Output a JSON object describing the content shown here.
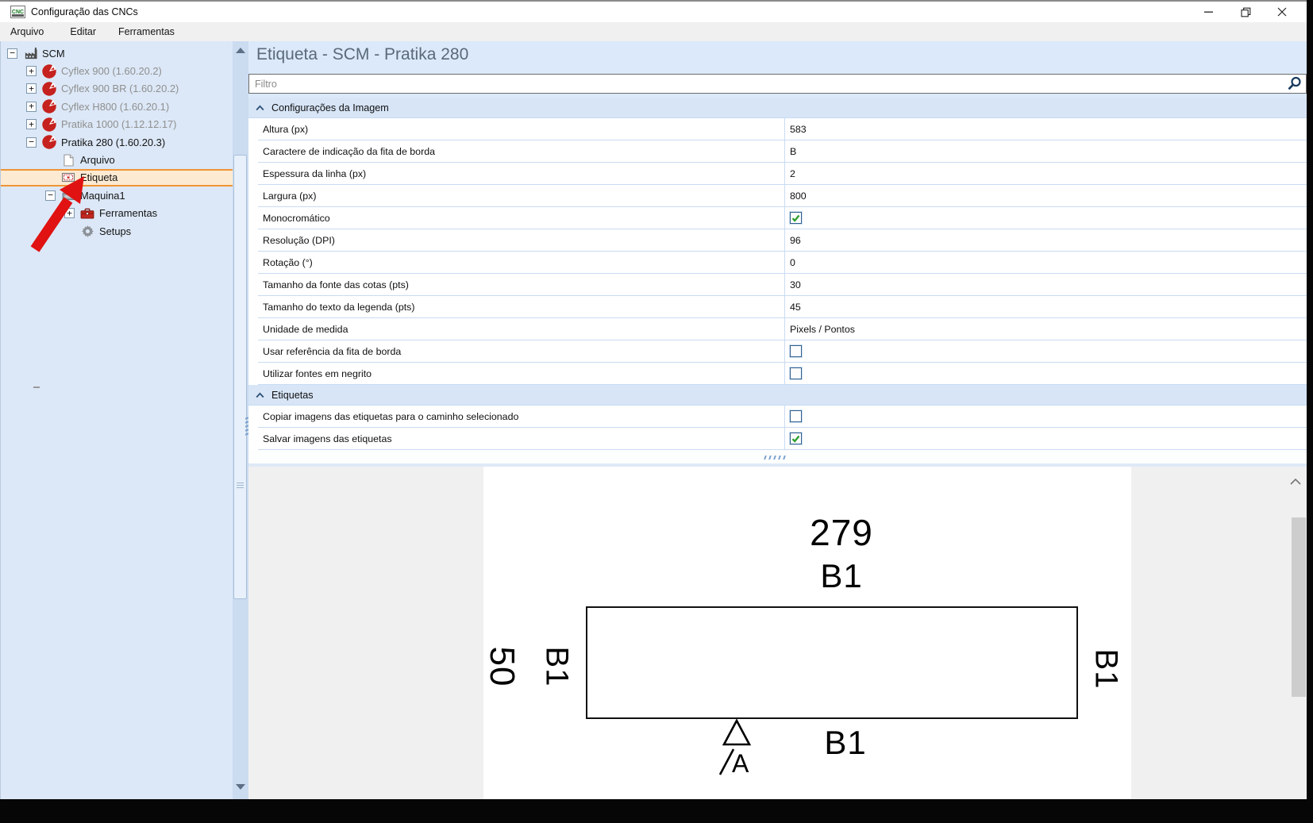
{
  "window": {
    "title": "Configuração das CNCs",
    "controls": [
      {
        "name": "minimize",
        "icon": "minimize-icon"
      },
      {
        "name": "restore",
        "icon": "restore-icon"
      },
      {
        "name": "close",
        "icon": "close-icon"
      }
    ]
  },
  "menu": {
    "items": [
      "Arquivo",
      "Editar",
      "Ferramentas"
    ]
  },
  "tree": {
    "items": [
      {
        "label": "SCM",
        "level": 0,
        "icon": "factory-icon",
        "expander": "minus",
        "muted": false,
        "selected": false
      },
      {
        "label": "Cyflex 900 (1.60.20.2)",
        "level": 1,
        "icon": "machine-logo-icon",
        "expander": "plus",
        "muted": true,
        "selected": false
      },
      {
        "label": "Cyflex 900 BR (1.60.20.2)",
        "level": 1,
        "icon": "machine-logo-icon",
        "expander": "plus",
        "muted": true,
        "selected": false
      },
      {
        "label": "Cyflex H800 (1.60.20.1)",
        "level": 1,
        "icon": "machine-logo-icon",
        "expander": "plus",
        "muted": true,
        "selected": false
      },
      {
        "label": "Pratika 1000 (1.12.12.17)",
        "level": 1,
        "icon": "machine-logo-icon",
        "expander": "plus",
        "muted": true,
        "selected": false
      },
      {
        "label": "Pratika 280 (1.60.20.3)",
        "level": 1,
        "icon": "machine-logo-icon",
        "expander": "minus",
        "muted": false,
        "selected": false
      },
      {
        "label": "Arquivo",
        "level": 2,
        "icon": "document-icon",
        "expander": "none",
        "muted": false,
        "selected": false
      },
      {
        "label": "Etiqueta",
        "level": 2,
        "icon": "label-icon",
        "expander": "none",
        "muted": false,
        "selected": true
      },
      {
        "label": "Maquina1",
        "level": 2,
        "icon": "machine-small-icon",
        "expander": "minus",
        "muted": false,
        "selected": false
      },
      {
        "label": "Ferramentas",
        "level": 3,
        "icon": "toolbox-icon",
        "expander": "plus",
        "muted": false,
        "selected": false
      },
      {
        "label": "Setups",
        "level": 3,
        "icon": "gear-icon",
        "expander": "none",
        "muted": false,
        "selected": false
      }
    ]
  },
  "main": {
    "title": "Etiqueta - SCM - Pratika 280",
    "filter_placeholder": "Filtro",
    "sections": [
      {
        "label": "Configurações da Imagem",
        "collapsed": false,
        "rows": [
          {
            "label": "Altura (px)",
            "type": "text",
            "value": "583"
          },
          {
            "label": "Caractere de indicação da fita de borda",
            "type": "text",
            "value": "B"
          },
          {
            "label": "Espessura da linha (px)",
            "type": "text",
            "value": "2"
          },
          {
            "label": "Largura (px)",
            "type": "text",
            "value": "800"
          },
          {
            "label": "Monocromático",
            "type": "checkbox",
            "checked": true
          },
          {
            "label": "Resolução (DPI)",
            "type": "text",
            "value": "96"
          },
          {
            "label": "Rotação (°)",
            "type": "text",
            "value": "0"
          },
          {
            "label": "Tamanho da fonte das cotas (pts)",
            "type": "text",
            "value": "30"
          },
          {
            "label": "Tamanho do texto da legenda (pts)",
            "type": "text",
            "value": "45"
          },
          {
            "label": "Unidade de medida",
            "type": "text",
            "value": "Pixels / Pontos"
          },
          {
            "label": "Usar referência da fita de borda",
            "type": "checkbox",
            "checked": false
          },
          {
            "label": "Utilizar fontes em negrito",
            "type": "checkbox",
            "checked": false
          }
        ]
      },
      {
        "label": "Etiquetas",
        "collapsed": false,
        "rows": [
          {
            "label": "Copiar imagens das etiquetas para o caminho selecionado",
            "type": "checkbox",
            "checked": false
          },
          {
            "label": "Salvar imagens das etiquetas",
            "type": "checkbox",
            "checked": true
          }
        ]
      }
    ]
  },
  "preview": {
    "top_dimension": "279",
    "top_edge_label": "B1",
    "left_dimension": "50",
    "left_edge_label": "B1",
    "right_edge_label": "B1",
    "bottom_edge_label": "B1",
    "datum_label": "A"
  },
  "colors": {
    "selection_orange": "#ef9434",
    "panel_blue": "#dce8f7",
    "section_blue": "#d7e5f7",
    "machine_red": "#c5211e",
    "check_green": "#2ea02e",
    "annotation_red": "#e01212"
  }
}
